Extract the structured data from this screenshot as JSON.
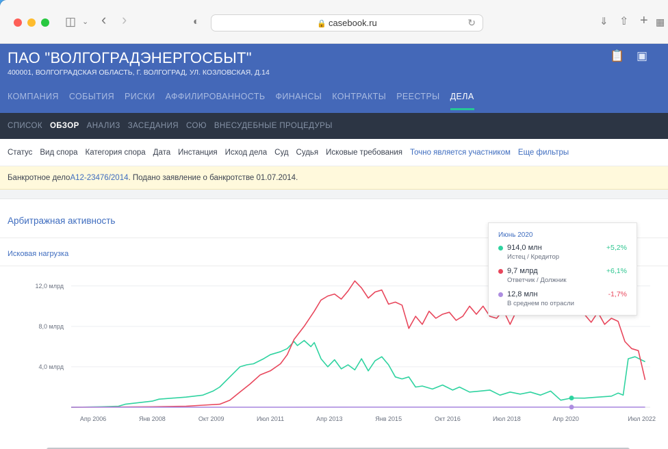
{
  "browser": {
    "url": "casebook.ru"
  },
  "company": {
    "name": "ПАО \"ВОЛГОГРАДЭНЕРГОСБЫТ\"",
    "address": "400001, ВОЛГОГРАДСКАЯ ОБЛАСТЬ, Г. ВОЛГОГРАД, УЛ. КОЗЛОВСКАЯ, Д.14"
  },
  "main_nav": [
    "КОМПАНИЯ",
    "СОБЫТИЯ",
    "РИСКИ",
    "АФФИЛИРОВАННОСТЬ",
    "ФИНАНСЫ",
    "КОНТРАКТЫ",
    "РЕЕСТРЫ",
    "ДЕЛА"
  ],
  "main_nav_active": "ДЕЛА",
  "sub_nav": [
    "СПИСОК",
    "ОБЗОР",
    "АНАЛИЗ",
    "ЗАСЕДАНИЯ",
    "СОЮ",
    "ВНЕСУДЕБНЫЕ ПРОЦЕДУРЫ"
  ],
  "sub_nav_active": "ОБЗОР",
  "filters": [
    "Статус",
    "Вид спора",
    "Категория спора",
    "Дата",
    "Инстанция",
    "Исход дела",
    "Суд",
    "Судья",
    "Исковые требования"
  ],
  "filter_links": [
    "Точно является участником",
    "Еще фильтры"
  ],
  "notice": {
    "prefix": "Банкротное дело ",
    "case_link": "А12-23476/2014",
    "suffix": ". Подано заявление о банкротстве 01.07.2014."
  },
  "panel": {
    "title": "Арбитражная активность",
    "subtitle": "Исковая нагрузка"
  },
  "tooltip": {
    "title": "Июнь 2020",
    "rows": [
      {
        "value": "914,0 млн",
        "role": "Истец / Кредитор",
        "change": "+5,2%",
        "color": "#2fd3a0",
        "change_color": "#2cc58f"
      },
      {
        "value": "9,7 млрд",
        "role": "Ответчик / Должник",
        "change": "+6,1%",
        "color": "#e8475c",
        "change_color": "#2cc58f"
      },
      {
        "value": "12,8 млн",
        "role": "В среднем по отрасли",
        "change": "-1,7%",
        "color": "#ad8de0",
        "change_color": "#e8475c"
      }
    ]
  },
  "chart_data": {
    "type": "line",
    "title": "",
    "ylabel": "",
    "xlabel": "",
    "ylim": [
      0,
      13000000000
    ],
    "xlim": [
      2005.6,
      2022.75
    ],
    "y_ticks": [
      {
        "value": 4000000000,
        "label": "4,0 млрд"
      },
      {
        "value": 8000000000,
        "label": "8,0 млрд"
      },
      {
        "value": 12000000000,
        "label": "12,0 млрд"
      }
    ],
    "x_ticks": [
      {
        "value": 2006.25,
        "label": "Апр 2006"
      },
      {
        "value": 2008.0,
        "label": "Янв 2008"
      },
      {
        "value": 2009.75,
        "label": "Окт 2009"
      },
      {
        "value": 2011.5,
        "label": "Июл 2011"
      },
      {
        "value": 2013.25,
        "label": "Апр 2013"
      },
      {
        "value": 2015.0,
        "label": "Янв 2015"
      },
      {
        "value": 2016.75,
        "label": "Окт 2016"
      },
      {
        "value": 2018.5,
        "label": "Июл 2018"
      },
      {
        "value": 2020.25,
        "label": "Апр 2020"
      },
      {
        "value": 2022.5,
        "label": "Июл 2022"
      }
    ],
    "grid": true,
    "highlight_x": 2020.42,
    "series": [
      {
        "name": "Истец / Кредитор",
        "color": "#2fd3a0",
        "x": [
          2005.6,
          2006.5,
          2007.0,
          2007.2,
          2008.0,
          2008.2,
          2009.0,
          2009.5,
          2009.8,
          2010.0,
          2010.3,
          2010.6,
          2010.8,
          2011.0,
          2011.3,
          2011.5,
          2011.8,
          2012.0,
          2012.2,
          2012.3,
          2012.5,
          2012.7,
          2012.8,
          2013.0,
          2013.2,
          2013.4,
          2013.6,
          2013.8,
          2014.0,
          2014.2,
          2014.4,
          2014.6,
          2014.8,
          2015.0,
          2015.2,
          2015.4,
          2015.6,
          2015.8,
          2016.0,
          2016.3,
          2016.6,
          2016.9,
          2017.1,
          2017.4,
          2017.7,
          2018.0,
          2018.3,
          2018.6,
          2018.9,
          2019.2,
          2019.5,
          2019.8,
          2020.1,
          2020.42,
          2020.8,
          2021.2,
          2021.6,
          2021.8,
          2021.95,
          2022.1,
          2022.3,
          2022.6
        ],
        "y": [
          0,
          50000000,
          100000000,
          300000000,
          600000000,
          800000000,
          1000000000,
          1200000000,
          1600000000,
          2000000000,
          3000000000,
          4000000000,
          4200000000,
          4300000000,
          4800000000,
          5200000000,
          5500000000,
          5800000000,
          6500000000,
          6100000000,
          6600000000,
          6000000000,
          6400000000,
          4800000000,
          4000000000,
          4700000000,
          3800000000,
          4200000000,
          3700000000,
          4800000000,
          3600000000,
          4600000000,
          5000000000,
          4200000000,
          3000000000,
          2800000000,
          3000000000,
          2000000000,
          2100000000,
          1800000000,
          2200000000,
          1700000000,
          2000000000,
          1500000000,
          1600000000,
          1700000000,
          1200000000,
          1500000000,
          1300000000,
          1500000000,
          1200000000,
          1600000000,
          700000000,
          914000000,
          900000000,
          1000000000,
          1100000000,
          1400000000,
          1200000000,
          4800000000,
          5000000000,
          4500000000
        ]
      },
      {
        "name": "Ответчик / Должник",
        "color": "#e8475c",
        "x": [
          2005.6,
          2008.0,
          2009.0,
          2009.5,
          2010.0,
          2010.3,
          2010.6,
          2010.9,
          2011.2,
          2011.5,
          2011.8,
          2012.0,
          2012.2,
          2012.5,
          2012.8,
          2013.0,
          2013.2,
          2013.4,
          2013.6,
          2013.8,
          2014.0,
          2014.2,
          2014.4,
          2014.6,
          2014.8,
          2015.0,
          2015.2,
          2015.4,
          2015.6,
          2015.8,
          2016.0,
          2016.2,
          2016.4,
          2016.6,
          2016.8,
          2017.0,
          2017.2,
          2017.4,
          2017.6,
          2017.8,
          2018.0,
          2018.2,
          2018.4,
          2018.6,
          2018.8,
          2019.0,
          2019.2,
          2019.4,
          2019.6,
          2019.8,
          2020.0,
          2020.2,
          2020.42,
          2020.6,
          2020.8,
          2021.0,
          2021.2,
          2021.4,
          2021.6,
          2021.8,
          2022.0,
          2022.2,
          2022.4,
          2022.6
        ],
        "y": [
          0,
          50000000,
          100000000,
          200000000,
          300000000,
          700000000,
          1500000000,
          2300000000,
          3200000000,
          3600000000,
          4300000000,
          5200000000,
          6700000000,
          8000000000,
          9500000000,
          10600000000,
          11000000000,
          11200000000,
          10700000000,
          11500000000,
          12500000000,
          11800000000,
          10800000000,
          11400000000,
          11600000000,
          10200000000,
          10400000000,
          10100000000,
          7800000000,
          9000000000,
          8200000000,
          9500000000,
          8800000000,
          9200000000,
          9400000000,
          8600000000,
          9000000000,
          10000000000,
          9200000000,
          10000000000,
          9000000000,
          8800000000,
          9600000000,
          8200000000,
          9600000000,
          10800000000,
          11200000000,
          10900000000,
          11100000000,
          10800000000,
          9800000000,
          10300000000,
          9700000000,
          10300000000,
          9200000000,
          8400000000,
          9400000000,
          8200000000,
          8800000000,
          8500000000,
          6500000000,
          5800000000,
          5600000000,
          2700000000
        ]
      },
      {
        "name": "В среднем по отрасли",
        "color": "#ad8de0",
        "x": [
          2005.6,
          2008.0,
          2012.0,
          2016.0,
          2019.0,
          2020.42,
          2021.5,
          2022.6
        ],
        "y": [
          8000000,
          9000000,
          10000000,
          11000000,
          12000000,
          12800000,
          12500000,
          12500000
        ]
      }
    ]
  }
}
